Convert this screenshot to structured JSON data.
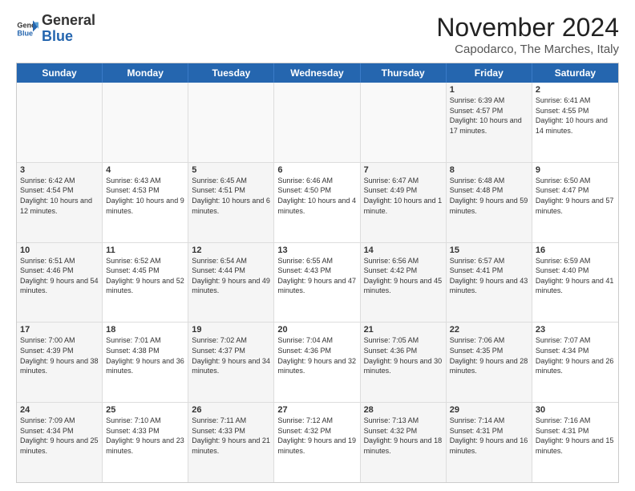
{
  "header": {
    "logo_general": "General",
    "logo_blue": "Blue",
    "month_title": "November 2024",
    "location": "Capodarco, The Marches, Italy"
  },
  "weekdays": [
    "Sunday",
    "Monday",
    "Tuesday",
    "Wednesday",
    "Thursday",
    "Friday",
    "Saturday"
  ],
  "rows": [
    [
      {
        "day": "",
        "info": "",
        "empty": true
      },
      {
        "day": "",
        "info": "",
        "empty": true
      },
      {
        "day": "",
        "info": "",
        "empty": true
      },
      {
        "day": "",
        "info": "",
        "empty": true
      },
      {
        "day": "",
        "info": "",
        "empty": true
      },
      {
        "day": "1",
        "info": "Sunrise: 6:39 AM\nSunset: 4:57 PM\nDaylight: 10 hours and 17 minutes.",
        "empty": false,
        "shaded": true
      },
      {
        "day": "2",
        "info": "Sunrise: 6:41 AM\nSunset: 4:55 PM\nDaylight: 10 hours and 14 minutes.",
        "empty": false
      }
    ],
    [
      {
        "day": "3",
        "info": "Sunrise: 6:42 AM\nSunset: 4:54 PM\nDaylight: 10 hours and 12 minutes.",
        "empty": false,
        "shaded": true
      },
      {
        "day": "4",
        "info": "Sunrise: 6:43 AM\nSunset: 4:53 PM\nDaylight: 10 hours and 9 minutes.",
        "empty": false
      },
      {
        "day": "5",
        "info": "Sunrise: 6:45 AM\nSunset: 4:51 PM\nDaylight: 10 hours and 6 minutes.",
        "empty": false,
        "shaded": true
      },
      {
        "day": "6",
        "info": "Sunrise: 6:46 AM\nSunset: 4:50 PM\nDaylight: 10 hours and 4 minutes.",
        "empty": false
      },
      {
        "day": "7",
        "info": "Sunrise: 6:47 AM\nSunset: 4:49 PM\nDaylight: 10 hours and 1 minute.",
        "empty": false,
        "shaded": true
      },
      {
        "day": "8",
        "info": "Sunrise: 6:48 AM\nSunset: 4:48 PM\nDaylight: 9 hours and 59 minutes.",
        "empty": false,
        "shaded": true
      },
      {
        "day": "9",
        "info": "Sunrise: 6:50 AM\nSunset: 4:47 PM\nDaylight: 9 hours and 57 minutes.",
        "empty": false
      }
    ],
    [
      {
        "day": "10",
        "info": "Sunrise: 6:51 AM\nSunset: 4:46 PM\nDaylight: 9 hours and 54 minutes.",
        "empty": false,
        "shaded": true
      },
      {
        "day": "11",
        "info": "Sunrise: 6:52 AM\nSunset: 4:45 PM\nDaylight: 9 hours and 52 minutes.",
        "empty": false
      },
      {
        "day": "12",
        "info": "Sunrise: 6:54 AM\nSunset: 4:44 PM\nDaylight: 9 hours and 49 minutes.",
        "empty": false,
        "shaded": true
      },
      {
        "day": "13",
        "info": "Sunrise: 6:55 AM\nSunset: 4:43 PM\nDaylight: 9 hours and 47 minutes.",
        "empty": false
      },
      {
        "day": "14",
        "info": "Sunrise: 6:56 AM\nSunset: 4:42 PM\nDaylight: 9 hours and 45 minutes.",
        "empty": false,
        "shaded": true
      },
      {
        "day": "15",
        "info": "Sunrise: 6:57 AM\nSunset: 4:41 PM\nDaylight: 9 hours and 43 minutes.",
        "empty": false,
        "shaded": true
      },
      {
        "day": "16",
        "info": "Sunrise: 6:59 AM\nSunset: 4:40 PM\nDaylight: 9 hours and 41 minutes.",
        "empty": false
      }
    ],
    [
      {
        "day": "17",
        "info": "Sunrise: 7:00 AM\nSunset: 4:39 PM\nDaylight: 9 hours and 38 minutes.",
        "empty": false,
        "shaded": true
      },
      {
        "day": "18",
        "info": "Sunrise: 7:01 AM\nSunset: 4:38 PM\nDaylight: 9 hours and 36 minutes.",
        "empty": false
      },
      {
        "day": "19",
        "info": "Sunrise: 7:02 AM\nSunset: 4:37 PM\nDaylight: 9 hours and 34 minutes.",
        "empty": false,
        "shaded": true
      },
      {
        "day": "20",
        "info": "Sunrise: 7:04 AM\nSunset: 4:36 PM\nDaylight: 9 hours and 32 minutes.",
        "empty": false
      },
      {
        "day": "21",
        "info": "Sunrise: 7:05 AM\nSunset: 4:36 PM\nDaylight: 9 hours and 30 minutes.",
        "empty": false,
        "shaded": true
      },
      {
        "day": "22",
        "info": "Sunrise: 7:06 AM\nSunset: 4:35 PM\nDaylight: 9 hours and 28 minutes.",
        "empty": false,
        "shaded": true
      },
      {
        "day": "23",
        "info": "Sunrise: 7:07 AM\nSunset: 4:34 PM\nDaylight: 9 hours and 26 minutes.",
        "empty": false
      }
    ],
    [
      {
        "day": "24",
        "info": "Sunrise: 7:09 AM\nSunset: 4:34 PM\nDaylight: 9 hours and 25 minutes.",
        "empty": false,
        "shaded": true
      },
      {
        "day": "25",
        "info": "Sunrise: 7:10 AM\nSunset: 4:33 PM\nDaylight: 9 hours and 23 minutes.",
        "empty": false
      },
      {
        "day": "26",
        "info": "Sunrise: 7:11 AM\nSunset: 4:33 PM\nDaylight: 9 hours and 21 minutes.",
        "empty": false,
        "shaded": true
      },
      {
        "day": "27",
        "info": "Sunrise: 7:12 AM\nSunset: 4:32 PM\nDaylight: 9 hours and 19 minutes.",
        "empty": false
      },
      {
        "day": "28",
        "info": "Sunrise: 7:13 AM\nSunset: 4:32 PM\nDaylight: 9 hours and 18 minutes.",
        "empty": false,
        "shaded": true
      },
      {
        "day": "29",
        "info": "Sunrise: 7:14 AM\nSunset: 4:31 PM\nDaylight: 9 hours and 16 minutes.",
        "empty": false,
        "shaded": true
      },
      {
        "day": "30",
        "info": "Sunrise: 7:16 AM\nSunset: 4:31 PM\nDaylight: 9 hours and 15 minutes.",
        "empty": false
      }
    ]
  ]
}
